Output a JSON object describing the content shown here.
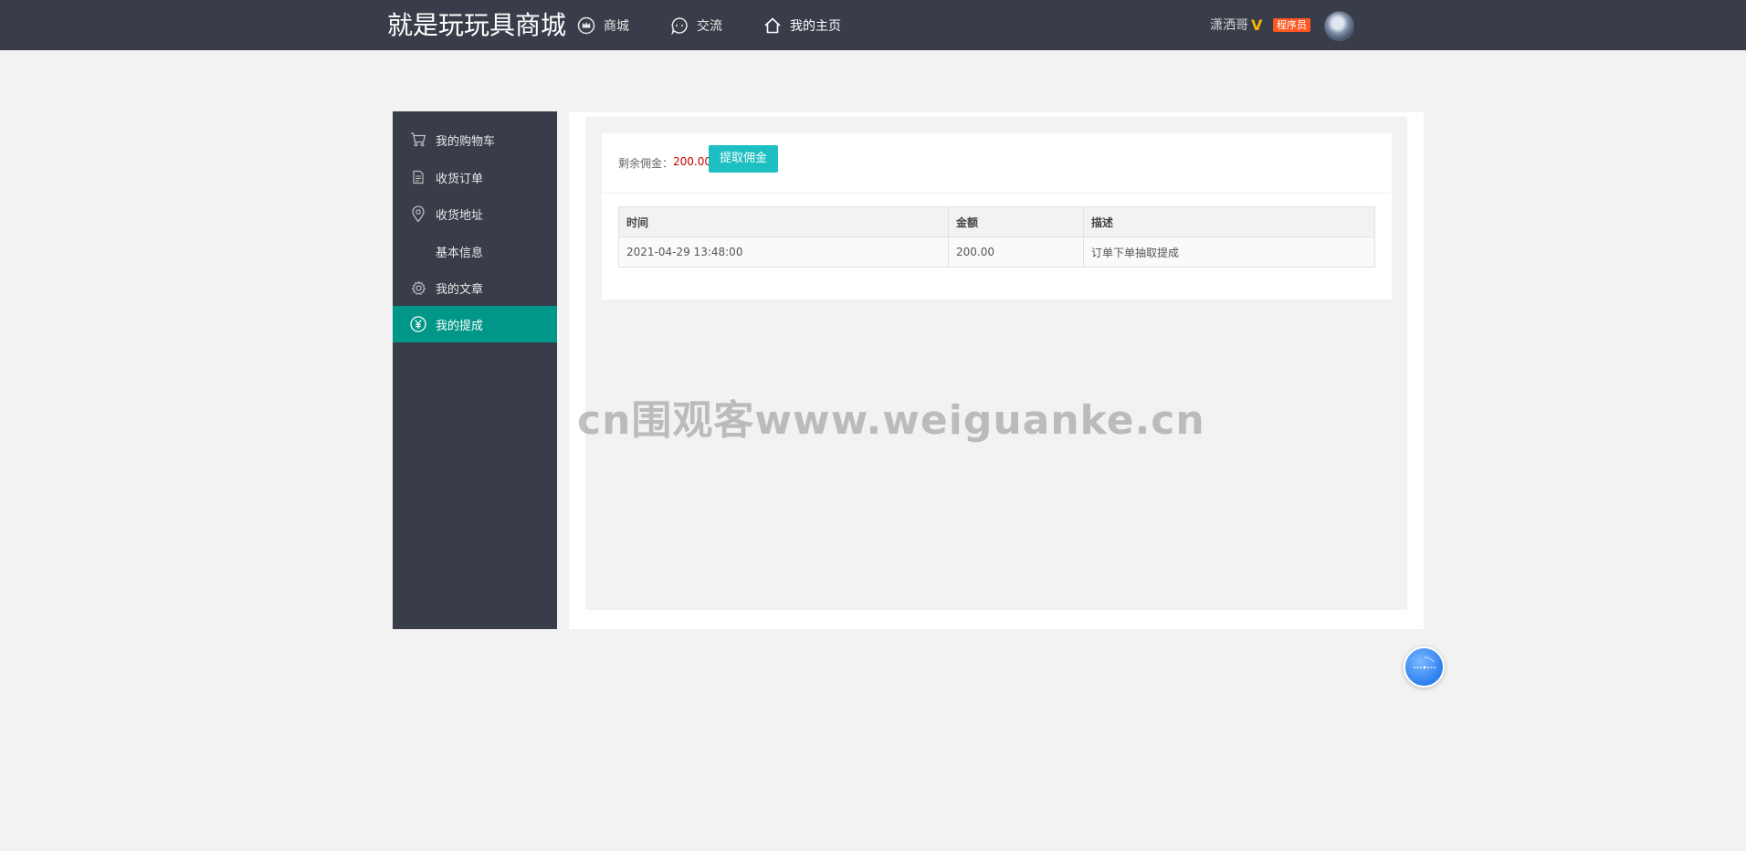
{
  "header": {
    "logo": "就是玩玩具商城",
    "nav": [
      {
        "label": "商城",
        "icon": "crown-icon"
      },
      {
        "label": "交流",
        "icon": "chat-icon"
      },
      {
        "label": "我的主页",
        "icon": "home-icon"
      }
    ],
    "active_nav": "我的主页",
    "user": {
      "name": "潇洒哥",
      "vip_mark": "V",
      "role_badge": "程序员",
      "avatar": "avatar-image"
    }
  },
  "sidebar": {
    "items": [
      {
        "label": "我的购物车",
        "icon": "cart-icon"
      },
      {
        "label": "收货订单",
        "icon": "document-icon"
      },
      {
        "label": "收货地址",
        "icon": "location-pin-icon"
      },
      {
        "label": "基本信息",
        "icon": ""
      },
      {
        "label": "我的文章",
        "icon": "gear-icon"
      },
      {
        "label": "我的提成",
        "icon": "yen-icon"
      }
    ],
    "active": "我的提成"
  },
  "commission": {
    "balance_label": "剩余佣金：",
    "balance_value": "200.00",
    "withdraw_button": "提取佣金",
    "table": {
      "columns": [
        "时间",
        "金额",
        "描述"
      ],
      "rows": [
        [
          "2021-04-29 13:48:00",
          "200.00",
          "订单下单抽取提成"
        ]
      ]
    }
  },
  "watermark": "cn围观客www.weiguanke.cn",
  "colors": {
    "header_bg": "#393d49",
    "sidebar_bg": "#393d49",
    "sidebar_active": "#009688",
    "button": "#1ebfc2",
    "amount_red": "#c00000",
    "badge": "#ff5722",
    "vip": "#f7b500"
  }
}
